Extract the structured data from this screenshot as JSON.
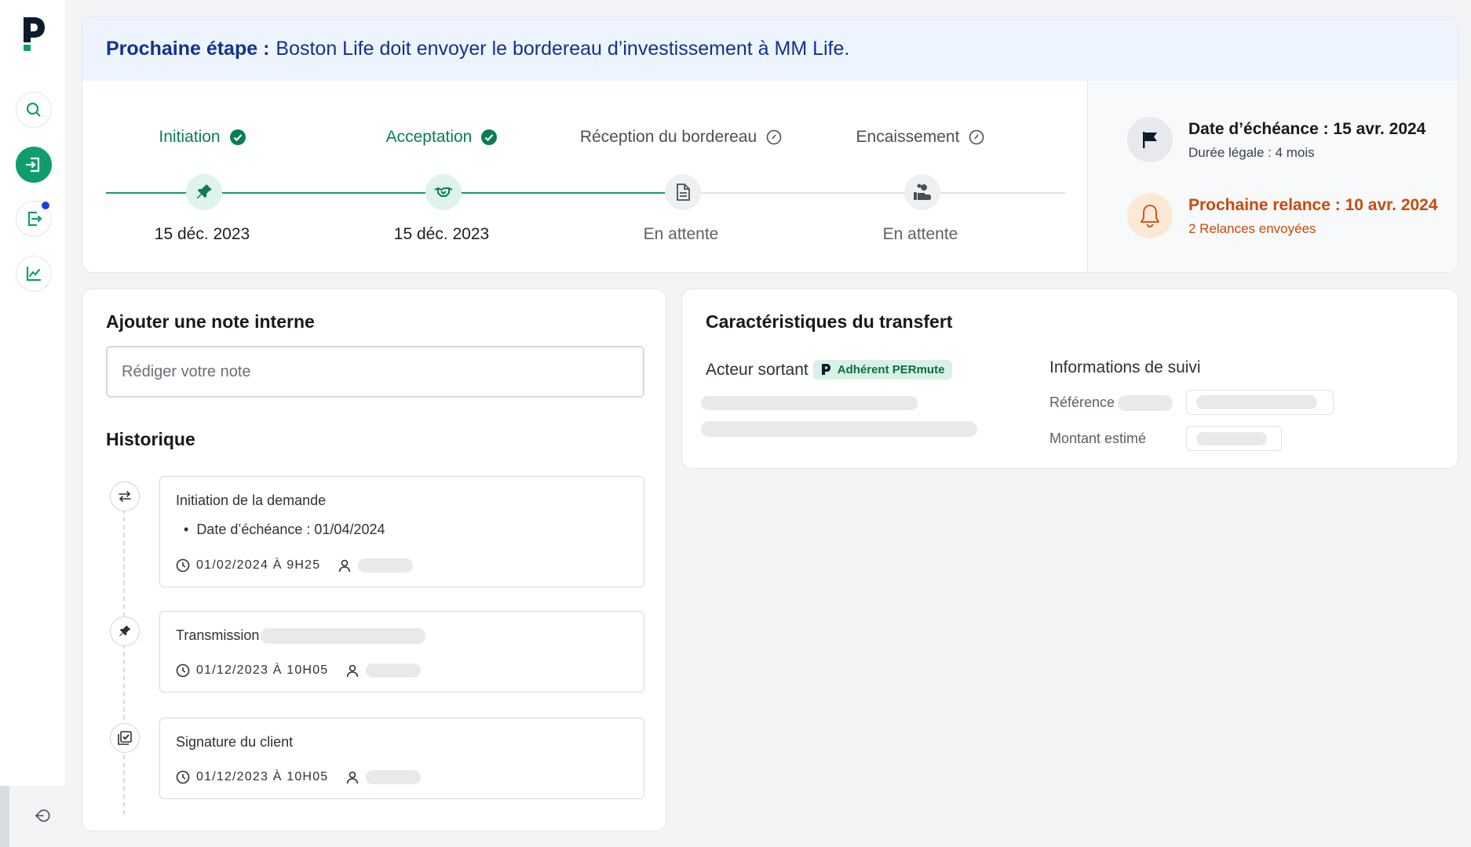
{
  "sidebar": {
    "nav": [
      {
        "name": "search",
        "active": false
      },
      {
        "name": "incoming-transfers",
        "active": true
      },
      {
        "name": "outgoing-transfers",
        "active": false,
        "notification": true
      },
      {
        "name": "analytics",
        "active": false
      }
    ]
  },
  "banner": {
    "lead": "Prochaine étape :",
    "text": "Boston Life doit envoyer le bordereau d’investissement à MM Life."
  },
  "steps": [
    {
      "label": "Initiation",
      "status": "done",
      "date": "15 déc. 2023",
      "icon": "pin-icon"
    },
    {
      "label": "Acceptation",
      "status": "done",
      "date": "15 déc. 2023",
      "icon": "handshake-icon"
    },
    {
      "label": "Réception du bordereau",
      "status": "pending",
      "date": "En attente",
      "icon": "document-icon"
    },
    {
      "label": "Encaissement",
      "status": "pending",
      "date": "En attente",
      "icon": "cash-hand-icon"
    }
  ],
  "deadline": {
    "title": "Date d’échéance : 15 avr. 2024",
    "subtitle": "Durée légale : 4 mois"
  },
  "reminder": {
    "title": "Prochaine relance : 10 avr. 2024",
    "subtitle": "2 Relances envoyées"
  },
  "notes": {
    "title": "Ajouter une note interne",
    "placeholder": "Rédiger votre note"
  },
  "history": {
    "title": "Historique",
    "events": [
      {
        "title": "Initiation de la demande",
        "bullet": "Date d’échéance : 01/04/2024",
        "timestamp": "01/02/2024 À 9H25",
        "icon": "swap-arrows-icon"
      },
      {
        "title": "Transmission",
        "timestamp": "01/12/2023 À 10H05",
        "icon": "pin-icon"
      },
      {
        "title": "Signature du client",
        "timestamp": "01/12/2023 À 10H05",
        "icon": "signed-checkbox-icon"
      }
    ]
  },
  "transfer": {
    "title": "Caractéristiques du transfert",
    "actor_label": "Acteur sortant",
    "actor_badge": "Adhérent PERmute",
    "follow_title": "Informations de suivi",
    "reference_label": "Référence",
    "amount_label": "Montant estimé"
  },
  "colors": {
    "brand_green": "#0f9d6e",
    "done_green": "#0a7d56",
    "banner_blue": "#12328f",
    "reminder_orange": "#c94a0c",
    "notification_blue": "#1d3fe0"
  }
}
